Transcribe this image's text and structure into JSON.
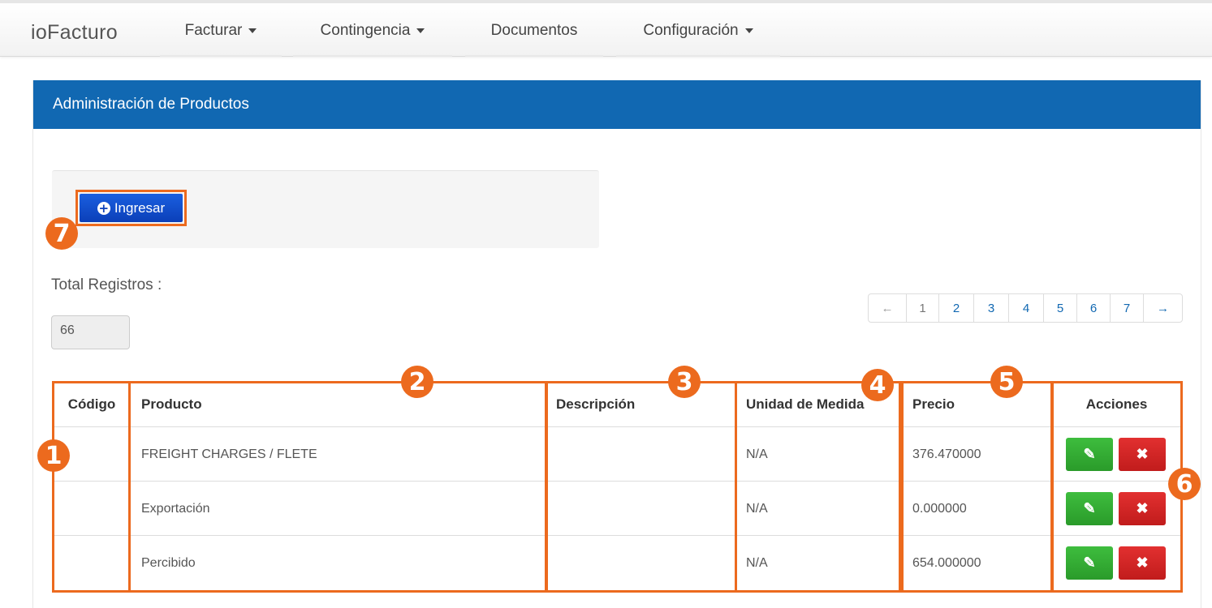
{
  "navbar": {
    "brand": "ioFacturo",
    "items": [
      {
        "label": "Facturar",
        "dropdown": true
      },
      {
        "label": "Contingencia",
        "dropdown": true
      },
      {
        "label": "Documentos",
        "dropdown": false
      },
      {
        "label": "Configuración",
        "dropdown": true
      }
    ]
  },
  "panel": {
    "title": "Administración de Productos"
  },
  "toolbar": {
    "add_label": "Ingresar"
  },
  "summary": {
    "total_label": "Total Registros :",
    "total_value": "66"
  },
  "pagination": {
    "prev": "←",
    "pages": [
      "1",
      "2",
      "3",
      "4",
      "5",
      "6",
      "7"
    ],
    "next": "→",
    "current": "1"
  },
  "table": {
    "headers": [
      "Código",
      "Producto",
      "Descripción",
      "Unidad de Medida",
      "Precio",
      "Acciones"
    ],
    "rows": [
      {
        "codigo": "",
        "producto": "FREIGHT CHARGES / FLETE",
        "descripcion": "",
        "unidad": "N/A",
        "precio": "376.470000"
      },
      {
        "codigo": "",
        "producto": "Exportación",
        "descripcion": "",
        "unidad": "N/A",
        "precio": "0.000000"
      },
      {
        "codigo": "",
        "producto": "Percibido",
        "descripcion": "",
        "unidad": "N/A",
        "precio": "654.000000"
      }
    ]
  },
  "annotations": [
    "1",
    "2",
    "3",
    "4",
    "5",
    "6",
    "7"
  ],
  "colors": {
    "accent": "#1168b2",
    "highlight": "#ec6a1e",
    "edit": "#2a9b2a",
    "delete": "#c11c1c"
  },
  "icons": {
    "add": "plus-circle-icon",
    "edit": "edit-icon",
    "delete": "close-icon"
  }
}
